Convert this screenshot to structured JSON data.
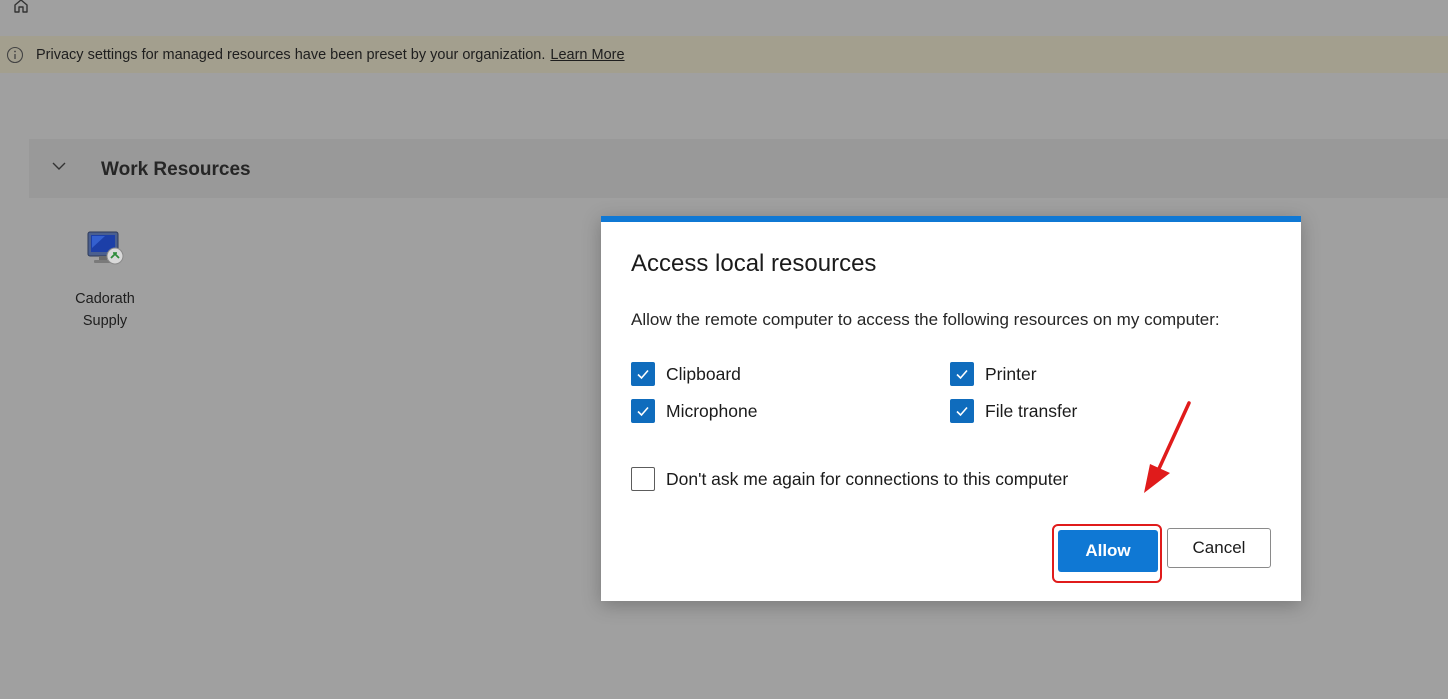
{
  "icons": {
    "home": "home-icon",
    "info": "info-icon",
    "chevron": "chevron-down-icon",
    "rdp": "remote-desktop-icon",
    "check": "checkmark-icon"
  },
  "banner": {
    "text": "Privacy settings for managed resources have been preset by your organization.",
    "link": "Learn More"
  },
  "group": {
    "title": "Work Resources"
  },
  "resources": [
    {
      "label_line1": "Cadorath",
      "label_line2": "Supply"
    }
  ],
  "dialog": {
    "title": "Access local resources",
    "description": "Allow the remote computer to access the following resources on my computer:",
    "options": [
      {
        "label": "Clipboard",
        "checked": true
      },
      {
        "label": "Printer",
        "checked": true
      },
      {
        "label": "Microphone",
        "checked": true
      },
      {
        "label": "File transfer",
        "checked": true
      }
    ],
    "dont_ask": {
      "label": "Don't ask me again for connections to this computer",
      "checked": false
    },
    "allow_label": "Allow",
    "cancel_label": "Cancel"
  },
  "colors": {
    "accent": "#0f78d4",
    "checkbox": "#0f6cbd",
    "annotation": "#e01b1b",
    "banner": "#a39f8e"
  }
}
